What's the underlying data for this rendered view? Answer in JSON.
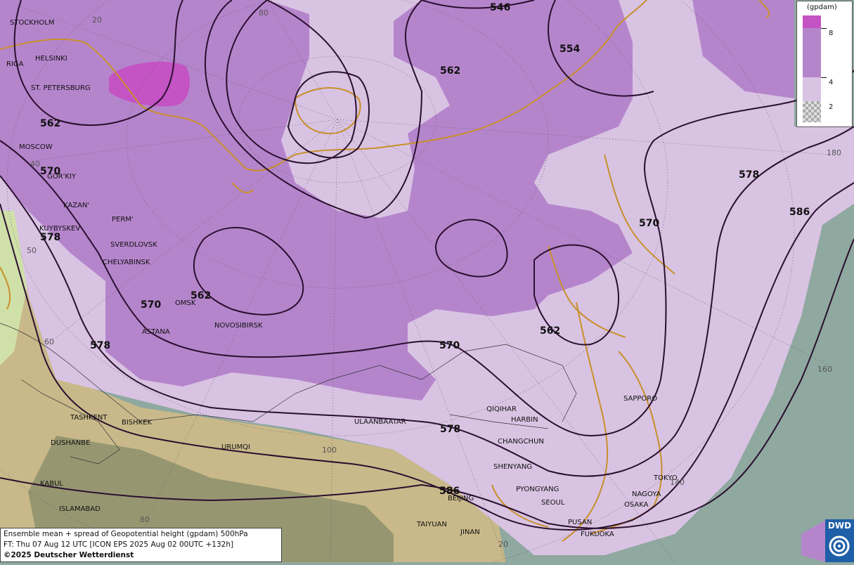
{
  "map": {
    "cities": [
      "STOCKHOLM",
      "HELSINKI",
      "RIGA",
      "ST. PETERSBURG",
      "MOSCOW",
      "GOR'KIY",
      "KAZAN'",
      "PERM'",
      "KUYBYSKEV",
      "SVERDLOVSK",
      "CHELYABINSK",
      "OMSK",
      "NOVOSIBIRSK",
      "ASTANA",
      "TASHKENT",
      "BISHKEK",
      "DUSHANBE",
      "URUMQI",
      "KABUL",
      "ISLAMABAD",
      "ULAANBAATAR",
      "QIQIHAR",
      "HARBIN",
      "CHANGCHUN",
      "SHENYANG",
      "PYONGYANG",
      "SEOUL",
      "BEIJING",
      "TAIYUAN",
      "JINAN",
      "PUSAN",
      "FUKUOKA",
      "OSAKA",
      "NAGOYA",
      "TOKYO",
      "SAPPORO"
    ],
    "contour_labels": [
      "546",
      "554",
      "562",
      "562",
      "570",
      "562",
      "570",
      "578",
      "562",
      "570",
      "578",
      "570",
      "578",
      "586",
      "578",
      "586"
    ],
    "grid_labels": [
      "20",
      "80",
      "40",
      "50",
      "60",
      "100",
      "80",
      "20",
      "180",
      "160",
      "140"
    ]
  },
  "legend": {
    "unit": "(gpdam)",
    "levels": [
      "8",
      "4",
      "2"
    ],
    "colors": [
      "#c453c4",
      "#b585cc",
      "#d9c3e3",
      "checker"
    ]
  },
  "info": {
    "line1": "Ensemble mean + spread of Geopotential height (gpdam) 500hPa",
    "line2": "FT: Thu 07 Aug 12 UTC [ICON EPS 2025 Aug 02 00UTC +132h]",
    "line3": "©2025 Deutscher Wetterdienst"
  },
  "logo": {
    "text": "DWD"
  },
  "colors": {
    "spread_high": "#c453c4",
    "spread_mid": "#b585cc",
    "spread_low": "#d9c3e3",
    "coast": "#c8902a",
    "contour": "#2a0f2e",
    "ocean": "#8fa8a0"
  }
}
